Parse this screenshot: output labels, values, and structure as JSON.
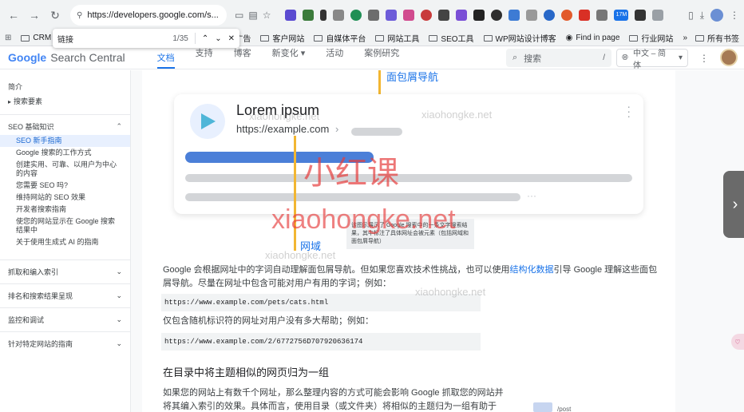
{
  "browser": {
    "url": "https://developers.google.com/s...",
    "bookmarks": [
      "CRM",
      "谷歌广告",
      "客户网站",
      "自媒体平台",
      "网站工具",
      "SEO工具",
      "WP网站设计博客",
      "Find in page",
      "行业网站"
    ],
    "all_bookmarks": "所有书签",
    "ext_badge": "17M"
  },
  "find": {
    "query": "链接",
    "count": "1/35"
  },
  "header": {
    "logo_google": "Google",
    "logo_suffix": "Search Central",
    "nav": [
      "文档",
      "支持",
      "博客",
      "新变化",
      "活动",
      "案例研究"
    ],
    "search_placeholder": "搜索",
    "search_shortcut": "/",
    "language": "中文 – 简体"
  },
  "sidebar": {
    "intro": "简介",
    "essentials": "搜索要素",
    "section_seo": "SEO 基础知识",
    "sub_items": [
      "SEO 新手指南",
      "Google 搜索的工作方式",
      "创建实用、可靠、以用户为中心的内容",
      "您需要 SEO 吗?",
      "维持网站的 SEO 效果",
      "开发者搜索指南",
      "使您的网站显示在 Google 搜索结果中",
      "关于使用生成式 AI 的指南"
    ],
    "collapsed": [
      "抓取和编入索引",
      "排名和搜索结果呈现",
      "监控和调试",
      "针对特定网站的指南"
    ]
  },
  "figure": {
    "title": "Lorem ipsum",
    "url": "https://example.com",
    "label_breadcrumb": "面包屑导航",
    "label_domain": "网域",
    "tooltip": "该图示展示了 Google 搜索中的一条文字搜索结果，其中标注了具体网址会被元素（包括网域和面包屑导航）"
  },
  "article": {
    "para1_a": "Google 会根据网址中的字词自动理解面包屑导航。但如果您喜欢技术性挑战，也可以使用",
    "para1_link": "结构化数据",
    "para1_b": "引导 Google 理解这些面包屑导航。尽量在网址中包含可能对用户有用的字词；例如：",
    "code1": "https://www.example.com/pets/cats.html",
    "para2": "仅包含随机标识符的网址对用户没有多大帮助；例如：",
    "code2": "https://www.example.com/2/6772756D707920636174",
    "h3": "在目录中将主题相似的网页归为一组",
    "para3": "如果您的网站上有数千个网址，那么整理内容的方式可能会影响 Google 抓取您的网站并将其编入索引的效果。具体而言，使用目录（或文件夹）将相似的主题归为一组有助于 Google 了解各",
    "thumb_label": "/post"
  },
  "watermark": {
    "cn": "小红课",
    "url": "xiaohongke.net"
  },
  "colors": {
    "accent": "#1a73e8",
    "callout": "#f2b632",
    "watermark": "#e63c3c"
  }
}
